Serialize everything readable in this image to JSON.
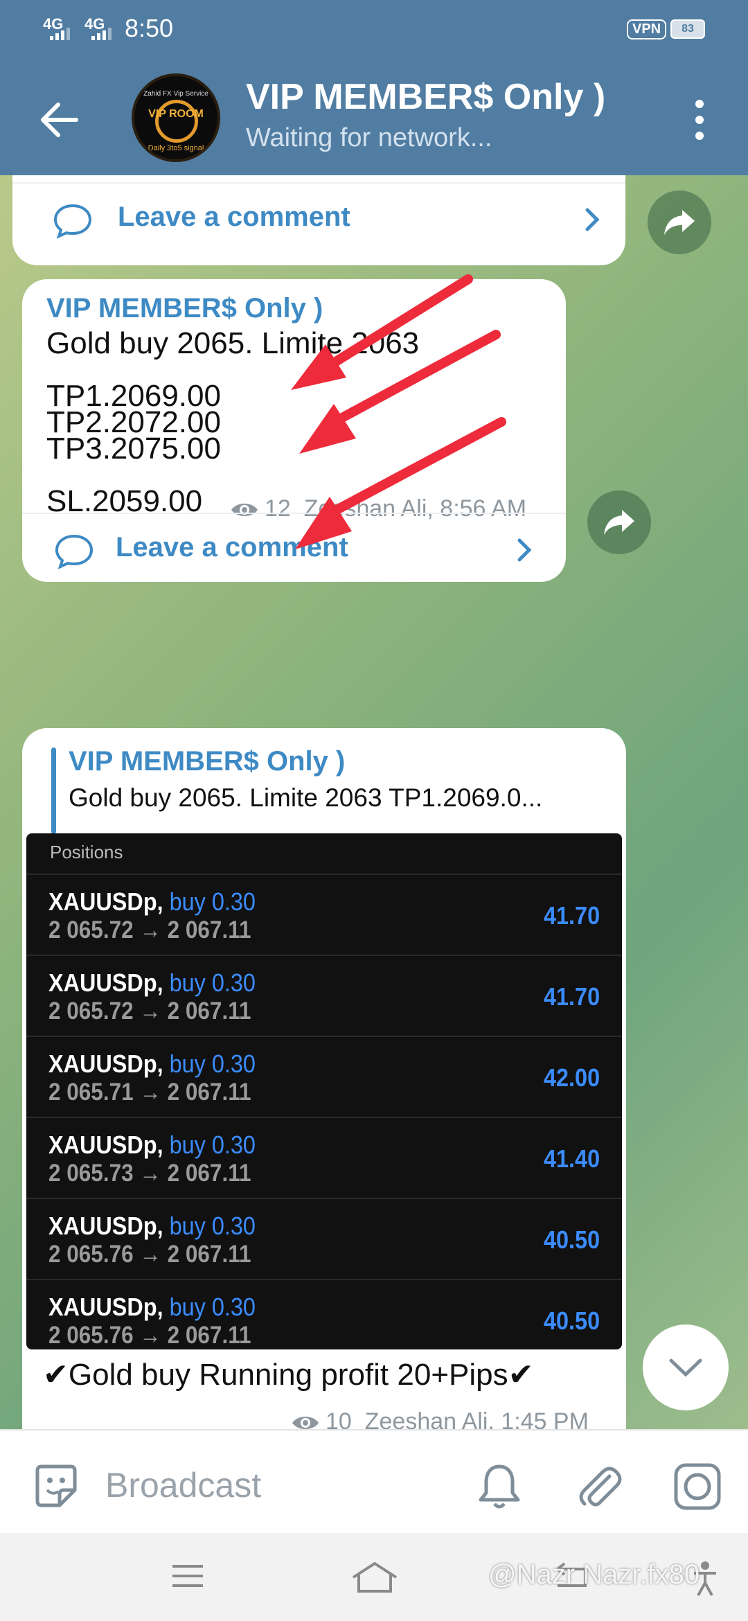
{
  "status_bar": {
    "signal_1": "4G",
    "signal_2": "4G",
    "time": "8:50",
    "vpn": "VPN",
    "battery": "83"
  },
  "header": {
    "title": "VIP MEMBER$ Only )",
    "subtitle": "Waiting for network..."
  },
  "avatar": {
    "line1": "Zahid FX Vip Service",
    "line2": "VIP ROOM",
    "line3": "Daily 3to5 signal"
  },
  "comment_label": "Leave a comment",
  "message1": {
    "author": "VIP MEMBER$ Only )",
    "lines": [
      "Gold buy 2065. Limite 2063",
      "",
      "TP1.2069.00",
      "TP2.2072.00",
      "TP3.2075.00",
      "",
      "SL.2059.00"
    ],
    "views": "12",
    "signature": "Zeeshan Ali, 8:56 AM"
  },
  "message2": {
    "reply_author": "VIP MEMBER$ Only )",
    "reply_text": "Gold buy 2065. Limite 2063  TP1.2069.0...",
    "positions_header": "Positions",
    "positions": [
      {
        "symbol": "XAUUSDp,",
        "side": "buy 0.30",
        "prices": "2 065.72 → 2 067.11",
        "profit": "41.70"
      },
      {
        "symbol": "XAUUSDp,",
        "side": "buy 0.30",
        "prices": "2 065.72 → 2 067.11",
        "profit": "41.70"
      },
      {
        "symbol": "XAUUSDp,",
        "side": "buy 0.30",
        "prices": "2 065.71 → 2 067.11",
        "profit": "42.00"
      },
      {
        "symbol": "XAUUSDp,",
        "side": "buy 0.30",
        "prices": "2 065.73 → 2 067.11",
        "profit": "41.40"
      },
      {
        "symbol": "XAUUSDp,",
        "side": "buy 0.30",
        "prices": "2 065.76 → 2 067.11",
        "profit": "40.50"
      },
      {
        "symbol": "XAUUSDp,",
        "side": "buy 0.30",
        "prices": "2 065.76 → 2 067.11",
        "profit": "40.50"
      }
    ],
    "caption": "✔Gold buy Running profit 20+Pips✔",
    "views": "10",
    "signature": "Zeeshan Ali, 1:45 PM"
  },
  "input": {
    "placeholder": "Broadcast"
  },
  "watermark": "@Nazr Nazr.fx80",
  "colors": {
    "header": "#517da2",
    "link": "#3e8ac4",
    "arrow": "#ee2b3b",
    "profit": "#3b8cff"
  }
}
